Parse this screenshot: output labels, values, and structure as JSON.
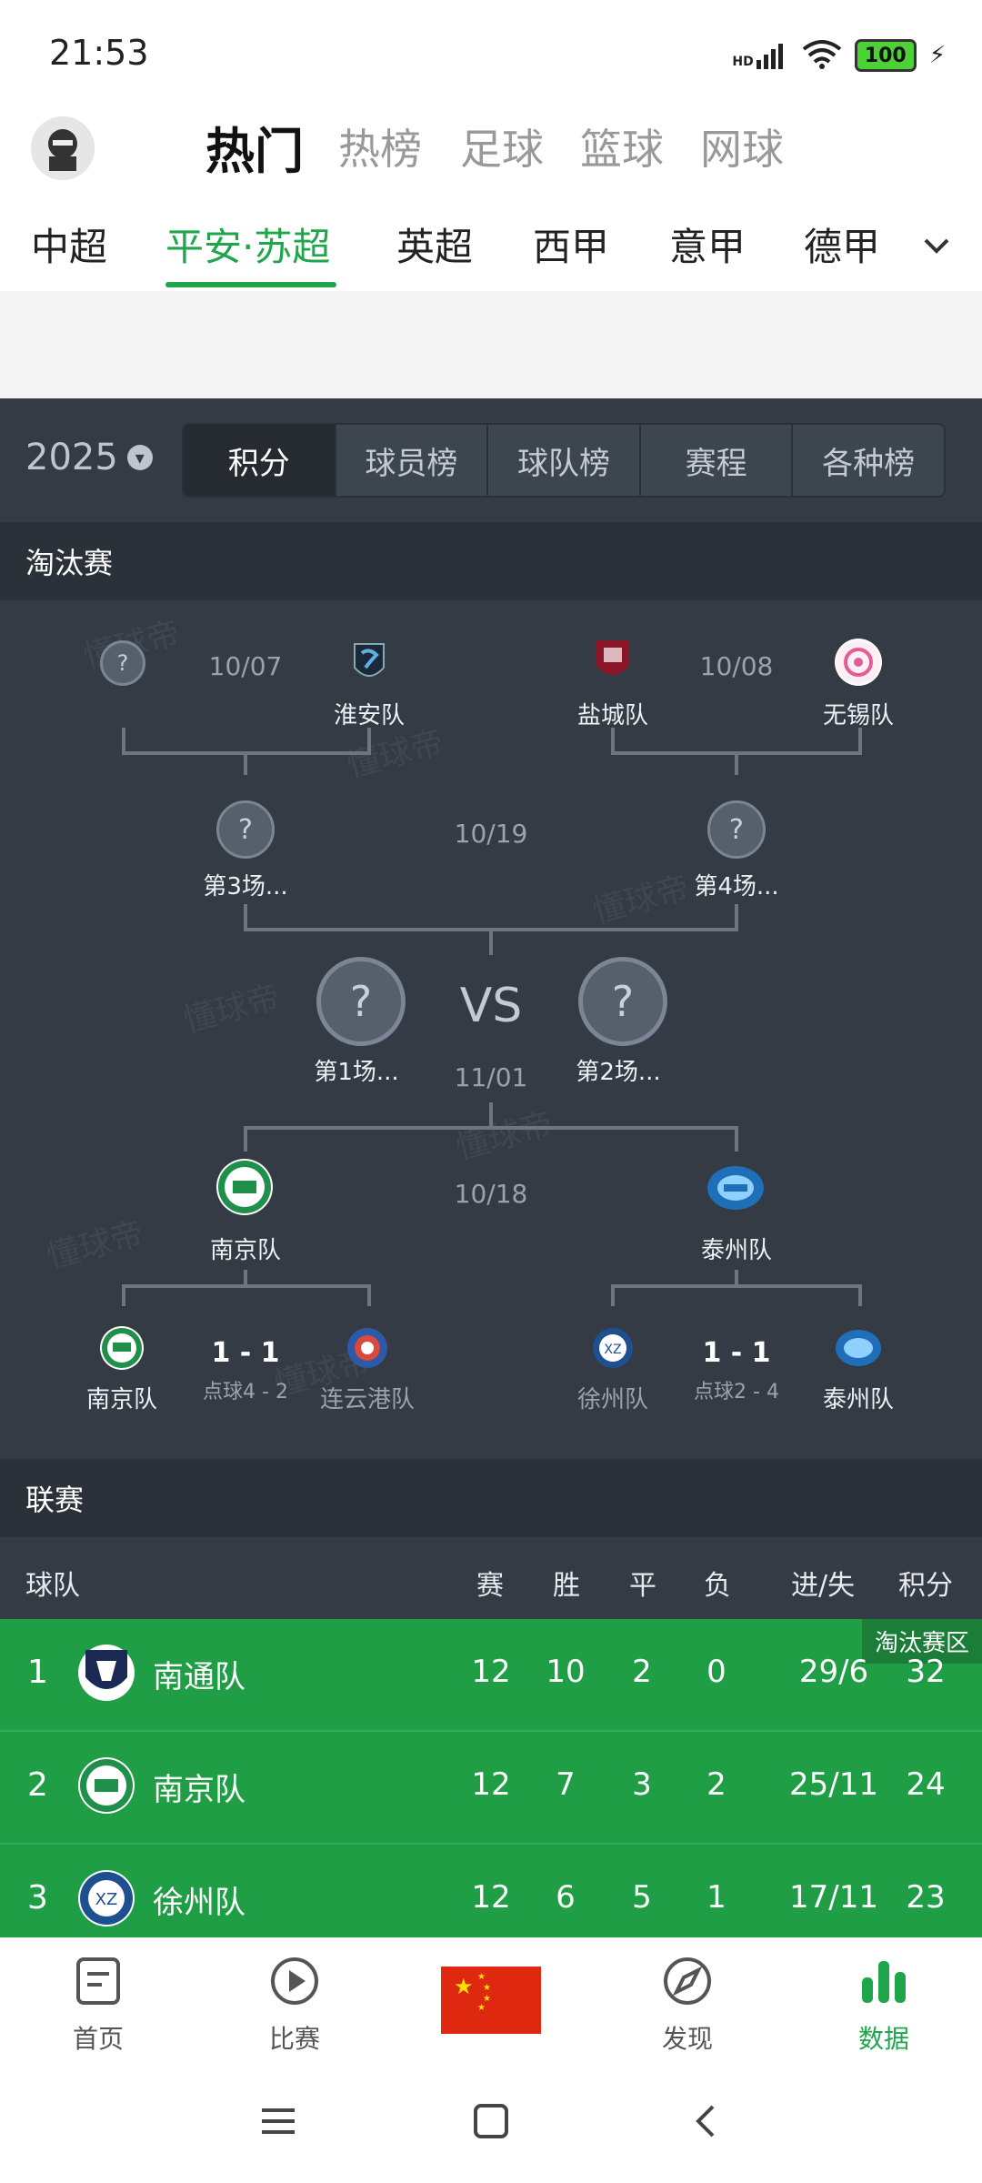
{
  "status_bar": {
    "time": "21:53",
    "signal_label": "HD",
    "battery": "100"
  },
  "top_tabs": [
    "热门",
    "热榜",
    "足球",
    "篮球",
    "网球"
  ],
  "league_tabs": [
    "中超",
    "平安·苏超",
    "英超",
    "西甲",
    "意甲",
    "德甲"
  ],
  "season": "2025",
  "segments": [
    "积分",
    "球员榜",
    "球队榜",
    "赛程",
    "各种榜"
  ],
  "knockout": {
    "title": "淘汰赛",
    "qf1": {
      "date": "10/07",
      "team_a": "",
      "team_b": "淮安队"
    },
    "qf2": {
      "date": "10/08",
      "team_a": "盐城队",
      "team_b": "无锡队"
    },
    "sf_upper": {
      "date": "10/19",
      "team_a": "第3场...",
      "team_b": "第4场..."
    },
    "final": {
      "vs": "VS",
      "date": "11/01",
      "team_a": "第1场...",
      "team_b": "第2场..."
    },
    "sf_lower": {
      "date": "10/18",
      "team_a": "南京队",
      "team_b": "泰州队"
    },
    "qf3": {
      "team_a": "南京队",
      "team_b": "连云港队",
      "score": "1 - 1",
      "pen": "点球4 - 2"
    },
    "qf4": {
      "team_a": "徐州队",
      "team_b": "泰州队",
      "score": "1 - 1",
      "pen": "点球2 - 4"
    }
  },
  "league": {
    "title": "联赛",
    "headers": {
      "team": "球队",
      "played": "赛",
      "won": "胜",
      "draw": "平",
      "lost": "负",
      "goals": "进/失",
      "points": "积分"
    },
    "zone_label": "淘汰赛区",
    "rows": [
      {
        "rank": "1",
        "team": "南通队",
        "played": "12",
        "won": "10",
        "draw": "2",
        "lost": "0",
        "goals": "29/6",
        "points": "32"
      },
      {
        "rank": "2",
        "team": "南京队",
        "played": "12",
        "won": "7",
        "draw": "3",
        "lost": "2",
        "goals": "25/11",
        "points": "24"
      },
      {
        "rank": "3",
        "team": "徐州队",
        "played": "12",
        "won": "6",
        "draw": "5",
        "lost": "1",
        "goals": "17/11",
        "points": "23"
      }
    ]
  },
  "bottom_nav": [
    "首页",
    "比赛",
    "发现",
    "数据"
  ],
  "watermark": "懂球帝",
  "colors": {
    "accent": "#1fa64b",
    "dark_bg": "#343b44",
    "row_green": "#1f9e46"
  }
}
